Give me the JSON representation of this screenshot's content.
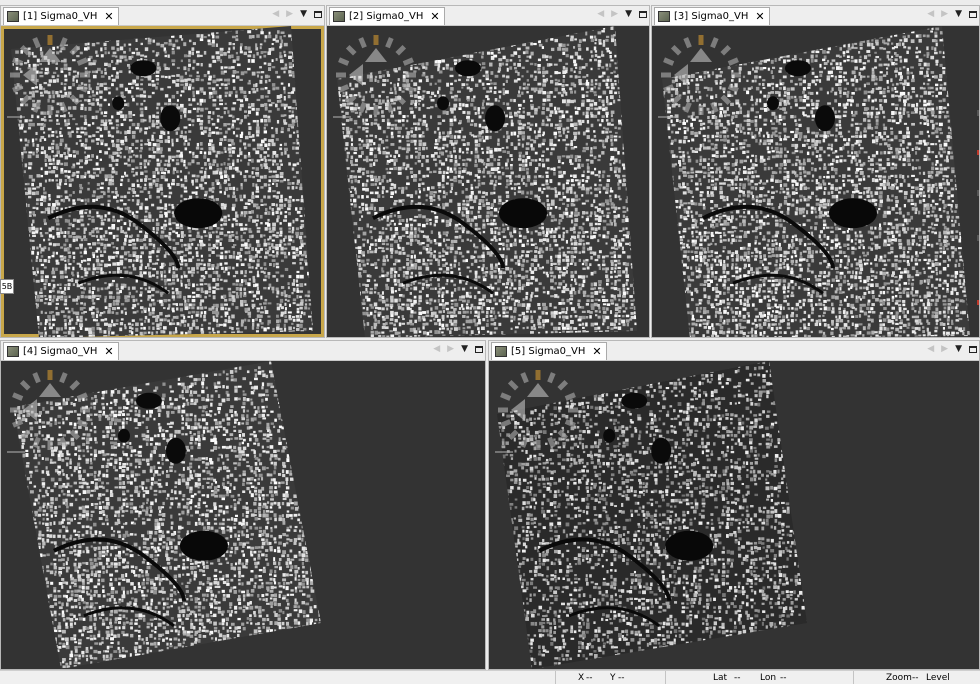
{
  "panels": [
    {
      "id": "p1",
      "title": "[1] Sigma0_VH",
      "selected": true
    },
    {
      "id": "p2",
      "title": "[2] Sigma0_VH",
      "selected": false
    },
    {
      "id": "p3",
      "title": "[3] Sigma0_VH",
      "selected": false
    },
    {
      "id": "p4",
      "title": "[4] Sigma0_VH",
      "selected": false
    },
    {
      "id": "p5",
      "title": "[5] Sigma0_VH",
      "selected": false
    }
  ],
  "tab_close_glyph": "✕",
  "icons": {
    "tab": "image-band-icon",
    "navigation": "pan-navigation-control-icon",
    "prev": "arrow-left-icon",
    "next": "arrow-right-icon",
    "menu": "dropdown-triangle-icon",
    "maximize": "maximize-window-icon"
  },
  "colors": {
    "background": "#333333",
    "selection": "#c8a74a",
    "tab": "#ffffff"
  },
  "side_badge": "5B",
  "status_bar": {
    "x_label": "X",
    "x_value": "--",
    "y_label": "Y",
    "y_value": "--",
    "lat_label": "Lat",
    "lat_value": "--",
    "lon_label": "Lon",
    "lon_value": "--",
    "zoom_label": "Zoom",
    "zoom_value": "--",
    "level_label": "Level"
  }
}
